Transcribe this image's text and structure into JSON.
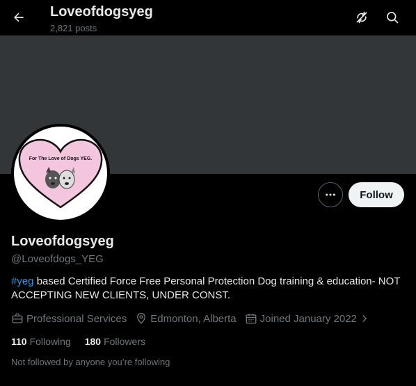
{
  "header": {
    "title": "Loveofdogsyeg",
    "posts_count": "2,821 posts"
  },
  "icons": {
    "back": "arrow-left-icon",
    "refresh": "refresh-off-icon",
    "search": "search-icon",
    "more": "more-icon",
    "category": "briefcase-icon",
    "location": "location-pin-icon",
    "joined": "calendar-icon"
  },
  "avatar": {
    "logo_text": "For The Love of Dogs YEG."
  },
  "actions": {
    "more_label": "•••",
    "follow_label": "Follow"
  },
  "profile": {
    "display_name": "Loveofdogsyeg",
    "handle": "@Loveofdogs_YEG",
    "bio_hashtag": "#yeg",
    "bio_rest": " based Certified Force Free Personal Protection Dog training & education- NOT ACCEPTING NEW CLIENTS, UNDER CONST.",
    "category": "Professional Services",
    "location": "Edmonton, Alberta",
    "joined": "Joined January 2022",
    "following_count": "110",
    "following_label": "Following",
    "followers_count": "180",
    "followers_label": "Followers",
    "not_followed_text": "Not followed by anyone you’re following"
  },
  "colors": {
    "background": "#000000",
    "banner": "#333639",
    "accent": "#1d9bf0",
    "muted": "#71767b",
    "text": "#e7e9ea",
    "heart_fill": "#f3c6de"
  }
}
